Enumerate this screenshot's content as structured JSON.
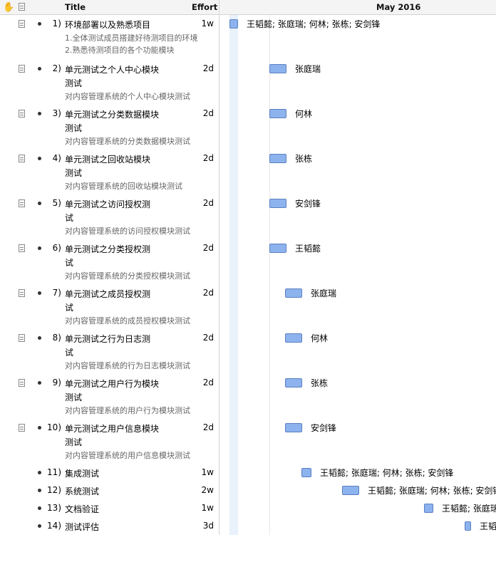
{
  "header": {
    "title_col": "Title",
    "effort_col": "Effort",
    "month": "May 2016",
    "drag_icon": "hand-grab-icon",
    "note_icon": "note-column-icon"
  },
  "rows": [
    {
      "num": "1)",
      "title": "环境部署以及熟悉项目",
      "effort": "1w",
      "notes": [
        "1.全体测试成员搭建好待测项目的环境",
        "2.熟悉待测项目的各个功能模块"
      ],
      "resources": "王韬懿; 张庭瑞; 何林; 张栋; 安剑锋"
    },
    {
      "num": "2)",
      "title": "单元测试之个人中心模块测试",
      "effort": "2d",
      "notes": [
        "对内容管理系统的个人中心模块测试"
      ],
      "resources": "张庭瑞"
    },
    {
      "num": "3)",
      "title": "单元测试之分类数据模块测试",
      "effort": "2d",
      "notes": [
        "对内容管理系统的分类数据模块测试"
      ],
      "resources": "何林"
    },
    {
      "num": "4)",
      "title": "单元测试之回收站模块测试",
      "effort": "2d",
      "notes": [
        "对内容管理系统的回收站模块测试"
      ],
      "resources": "张栋"
    },
    {
      "num": "5)",
      "title": "单元测试之访问授权测试",
      "effort": "2d",
      "notes": [
        "对内容管理系统的访问授权模块测试"
      ],
      "resources": "安剑锋"
    },
    {
      "num": "6)",
      "title": "单元测试之分类授权测试",
      "effort": "2d",
      "notes": [
        "对内容管理系统的分类授权模块测试"
      ],
      "resources": "王韬懿"
    },
    {
      "num": "7)",
      "title": "单元测试之成员授权测试",
      "effort": "2d",
      "notes": [
        "对内容管理系统的成员授权模块测试"
      ],
      "resources": "张庭瑞"
    },
    {
      "num": "8)",
      "title": "单元测试之行为日志测试",
      "effort": "2d",
      "notes": [
        "对内容管理系统的行为日志模块测试"
      ],
      "resources": "何林"
    },
    {
      "num": "9)",
      "title": "单元测试之用户行为模块测试",
      "effort": "2d",
      "notes": [
        "对内容管理系统的用户行为模块测试"
      ],
      "resources": "张栋"
    },
    {
      "num": "10)",
      "title": "单元测试之用户信息模块测试",
      "effort": "2d",
      "notes": [
        "对内容管理系统的用户信息模块测试"
      ],
      "resources": "安剑锋"
    },
    {
      "num": "11)",
      "title": "集成测试",
      "effort": "1w",
      "notes": [],
      "resources": "王韬懿; 张庭瑞; 何林; 张栋; 安剑锋"
    },
    {
      "num": "12)",
      "title": "系统测试",
      "effort": "2w",
      "notes": [],
      "resources": "王韬懿; 张庭瑞; 何林; 张栋; 安剑锋"
    },
    {
      "num": "13)",
      "title": "文档验证",
      "effort": "1w",
      "notes": [],
      "resources": "王韬懿; 张庭瑞; 何林; 张栋; 安剑锋"
    },
    {
      "num": "14)",
      "title": "测试评估",
      "effort": "3d",
      "notes": [],
      "resources": "王韬懿; 张庭瑞; 何林; 张栋; 安剑锋"
    }
  ]
}
